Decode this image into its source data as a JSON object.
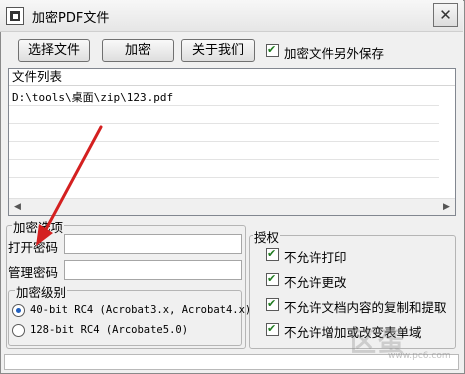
{
  "window": {
    "title": "加密PDF文件",
    "close_label": "✕"
  },
  "toolbar": {
    "select_file": "选择文件",
    "encrypt": "加密",
    "about": "关于我们",
    "save_separately_label": "加密文件另外保存",
    "save_separately_checked": true
  },
  "file_list": {
    "header": "文件列表",
    "files": [
      "D:\\tools\\桌面\\zip\\123.pdf"
    ]
  },
  "encrypt_options": {
    "group_title": "加密选项",
    "open_password_label": "打开密码",
    "open_password_value": "",
    "admin_password_label": "管理密码",
    "admin_password_value": "",
    "level_group_title": "加密级别",
    "levels": [
      {
        "label": "40-bit RC4 (Acrobat3.x, Acrobat4.x)",
        "selected": true
      },
      {
        "label": "128-bit RC4 (Arcobate5.0)",
        "selected": false
      }
    ]
  },
  "permissions": {
    "group_title": "授权",
    "items": [
      {
        "label": "不允许打印",
        "checked": true
      },
      {
        "label": "不允许更改",
        "checked": true
      },
      {
        "label": "不允许文档内容的复制和提取",
        "checked": true
      },
      {
        "label": "不允许增加或改变表单域",
        "checked": true
      }
    ]
  },
  "watermark": {
    "brand": "区蛋",
    "url": "www.pc6.com"
  }
}
